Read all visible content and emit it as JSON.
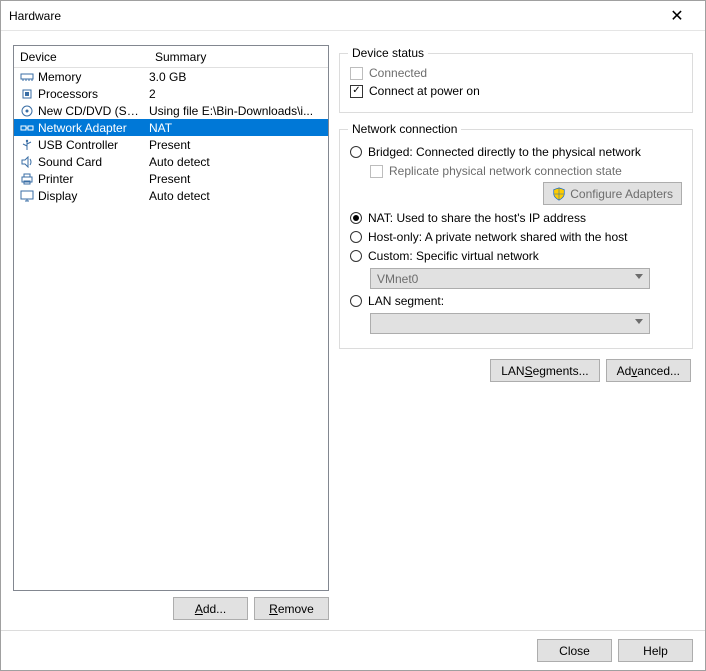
{
  "window": {
    "title": "Hardware"
  },
  "columns": {
    "device": "Device",
    "summary": "Summary"
  },
  "devices": [
    {
      "name": "Memory",
      "summary": "3.0 GB",
      "icon": "memory"
    },
    {
      "name": "Processors",
      "summary": "2",
      "icon": "cpu"
    },
    {
      "name": "New CD/DVD (SATA)",
      "summary": "Using file E:\\Bin-Downloads\\i...",
      "icon": "disc"
    },
    {
      "name": "Network Adapter",
      "summary": "NAT",
      "icon": "net",
      "selected": true
    },
    {
      "name": "USB Controller",
      "summary": "Present",
      "icon": "usb"
    },
    {
      "name": "Sound Card",
      "summary": "Auto detect",
      "icon": "sound"
    },
    {
      "name": "Printer",
      "summary": "Present",
      "icon": "printer"
    },
    {
      "name": "Display",
      "summary": "Auto detect",
      "icon": "display"
    }
  ],
  "left_buttons": {
    "add": "Add...",
    "remove": "Remove"
  },
  "device_status": {
    "legend": "Device status",
    "connected": "Connected",
    "connect_power": "Connect at power on",
    "connected_checked": false,
    "connect_power_checked": true
  },
  "network": {
    "legend": "Network connection",
    "bridged": "Bridged: Connected directly to the physical network",
    "replicate": "Replicate physical network connection state",
    "configure": "Configure Adapters",
    "nat": "NAT: Used to share the host's IP address",
    "hostonly": "Host-only: A private network shared with the host",
    "custom": "Custom: Specific virtual network",
    "custom_value": "VMnet0",
    "lanseg": "LAN segment:",
    "lanseg_value": "",
    "selected": "nat",
    "lan_segments_btn": "LAN Segments...",
    "advanced_btn": "Advanced..."
  },
  "footer": {
    "close": "Close",
    "help": "Help"
  }
}
